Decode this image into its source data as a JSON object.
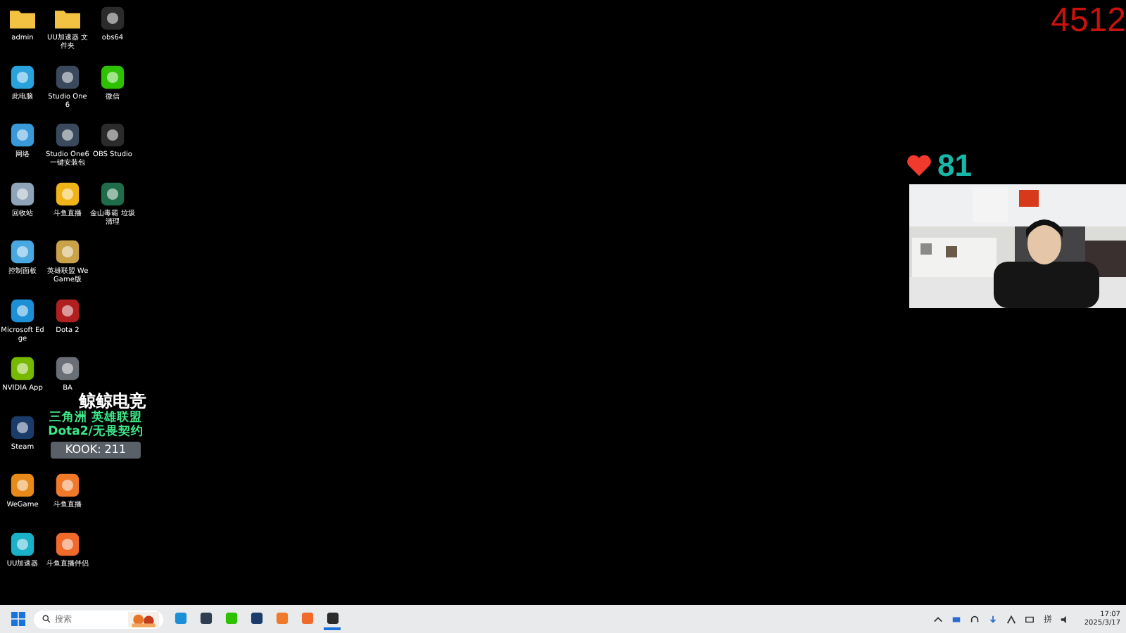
{
  "viewer_count": "4512",
  "likes": {
    "count": "81"
  },
  "overlay": {
    "title": "鲸鲸电竞",
    "lines": [
      "三角洲 英雄联盟",
      "Dota2/无畏契约"
    ],
    "badge": "KOOK: 211"
  },
  "desktop_icons": [
    {
      "label": "admin",
      "kind": "folder",
      "color": "#f4c242"
    },
    {
      "label": "此电脑",
      "kind": "app",
      "color": "#2aa3dd"
    },
    {
      "label": "网络",
      "kind": "app",
      "color": "#3a9ad9"
    },
    {
      "label": "回收站",
      "kind": "app",
      "color": "#8fa4b8"
    },
    {
      "label": "控制面板",
      "kind": "app",
      "color": "#4aa8e0"
    },
    {
      "label": "Microsoft Edge",
      "kind": "app",
      "color": "#1c8fd6"
    },
    {
      "label": "NVIDIA App",
      "kind": "app",
      "color": "#76b900"
    },
    {
      "label": "Steam",
      "kind": "app",
      "color": "#1b3c6b"
    },
    {
      "label": "WeGame",
      "kind": "app",
      "color": "#e88a1a"
    },
    {
      "label": "UU加速器",
      "kind": "app",
      "color": "#1ab0c8"
    },
    {
      "label": "UU加速器 文件夹",
      "kind": "folder",
      "color": "#f4c242"
    },
    {
      "label": "Studio One 6",
      "kind": "app",
      "color": "#3a4a5c"
    },
    {
      "label": "Studio One6 一键安装包",
      "kind": "app",
      "color": "#3a4a5c"
    },
    {
      "label": "斗鱼直播",
      "kind": "app",
      "color": "#f1b418"
    },
    {
      "label": "英雄联盟 WeGame版",
      "kind": "app",
      "color": "#c9a24a"
    },
    {
      "label": "Dota 2",
      "kind": "app",
      "color": "#b02020"
    },
    {
      "label": "BA",
      "kind": "app",
      "color": "#6a6f76"
    },
    {
      "label": "斗鱼直播",
      "kind": "app",
      "color": "#f07a2a"
    },
    {
      "label": "斗鱼直播伴侣",
      "kind": "app",
      "color": "#f06a2a"
    },
    {
      "label": "obs64",
      "kind": "app",
      "color": "#2b2b2b"
    },
    {
      "label": "微信",
      "kind": "app",
      "color": "#2dc100"
    },
    {
      "label": "OBS Studio",
      "kind": "app",
      "color": "#2b2b2b"
    },
    {
      "label": "金山毒霸 垃圾清理",
      "kind": "app",
      "color": "#1f6b4a"
    }
  ],
  "taskbar": {
    "search": {
      "placeholder": "搜索"
    },
    "apps": [
      {
        "color": "#1c8fd6",
        "active": false
      },
      {
        "color": "#2c3e50",
        "active": false
      },
      {
        "color": "#2dc100",
        "active": false
      },
      {
        "color": "#1b3c6b",
        "active": false
      },
      {
        "color": "#f07a2a",
        "active": false
      },
      {
        "color": "#f06a2a",
        "active": false
      },
      {
        "color": "#2b2b2b",
        "active": true
      }
    ],
    "ime": "拼",
    "time": "17:07",
    "date": "2025/3/17"
  }
}
